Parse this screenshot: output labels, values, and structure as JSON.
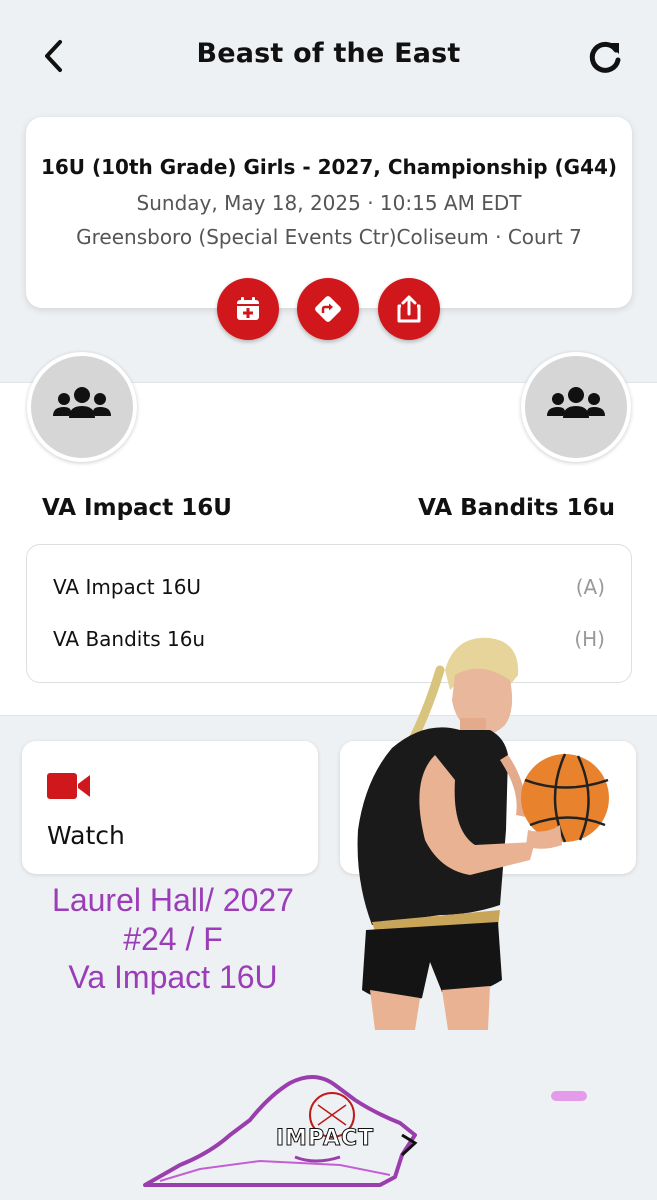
{
  "header": {
    "title": "Beast of the East"
  },
  "game": {
    "division": "16U (10th Grade) Girls - 2027, Championship (G44)",
    "datetime": "Sunday, May 18, 2025 · 10:15 AM EDT",
    "venue": "Greensboro (Special Events Ctr)Coliseum · Court 7"
  },
  "actions": [
    "calendar-add-icon",
    "directions-icon",
    "share-icon"
  ],
  "teams": {
    "away": {
      "name": "VA Impact 16U",
      "tag": "(A)"
    },
    "home": {
      "name": "VA Bandits 16u",
      "tag": "(H)"
    }
  },
  "watch": {
    "label": "Watch",
    "icon": "video-camera-icon"
  },
  "player": {
    "line1": "Laurel Hall/ 2027",
    "line2": "#24 / F",
    "line3": "Va Impact 16U"
  },
  "logo": {
    "text": "IMPACT"
  },
  "colors": {
    "accent": "#d0181c",
    "caption": "#9b3cb8",
    "background": "#eef1f3"
  }
}
